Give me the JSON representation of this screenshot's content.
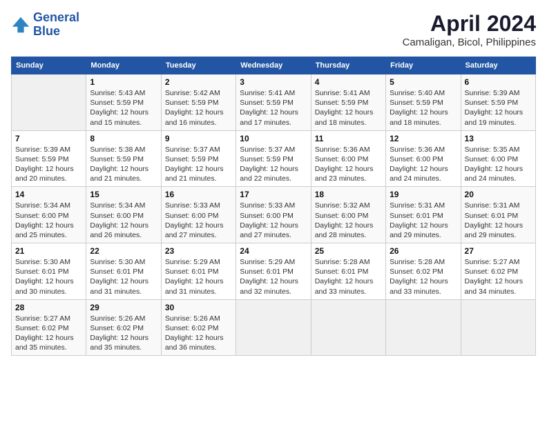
{
  "header": {
    "logo_line1": "General",
    "logo_line2": "Blue",
    "month_year": "April 2024",
    "location": "Camaligan, Bicol, Philippines"
  },
  "days_of_week": [
    "Sunday",
    "Monday",
    "Tuesday",
    "Wednesday",
    "Thursday",
    "Friday",
    "Saturday"
  ],
  "weeks": [
    [
      {
        "day": "",
        "sunrise": "",
        "sunset": "",
        "daylight": ""
      },
      {
        "day": "1",
        "sunrise": "Sunrise: 5:43 AM",
        "sunset": "Sunset: 5:59 PM",
        "daylight": "Daylight: 12 hours and 15 minutes."
      },
      {
        "day": "2",
        "sunrise": "Sunrise: 5:42 AM",
        "sunset": "Sunset: 5:59 PM",
        "daylight": "Daylight: 12 hours and 16 minutes."
      },
      {
        "day": "3",
        "sunrise": "Sunrise: 5:41 AM",
        "sunset": "Sunset: 5:59 PM",
        "daylight": "Daylight: 12 hours and 17 minutes."
      },
      {
        "day": "4",
        "sunrise": "Sunrise: 5:41 AM",
        "sunset": "Sunset: 5:59 PM",
        "daylight": "Daylight: 12 hours and 18 minutes."
      },
      {
        "day": "5",
        "sunrise": "Sunrise: 5:40 AM",
        "sunset": "Sunset: 5:59 PM",
        "daylight": "Daylight: 12 hours and 18 minutes."
      },
      {
        "day": "6",
        "sunrise": "Sunrise: 5:39 AM",
        "sunset": "Sunset: 5:59 PM",
        "daylight": "Daylight: 12 hours and 19 minutes."
      }
    ],
    [
      {
        "day": "7",
        "sunrise": "Sunrise: 5:39 AM",
        "sunset": "Sunset: 5:59 PM",
        "daylight": "Daylight: 12 hours and 20 minutes."
      },
      {
        "day": "8",
        "sunrise": "Sunrise: 5:38 AM",
        "sunset": "Sunset: 5:59 PM",
        "daylight": "Daylight: 12 hours and 21 minutes."
      },
      {
        "day": "9",
        "sunrise": "Sunrise: 5:37 AM",
        "sunset": "Sunset: 5:59 PM",
        "daylight": "Daylight: 12 hours and 21 minutes."
      },
      {
        "day": "10",
        "sunrise": "Sunrise: 5:37 AM",
        "sunset": "Sunset: 5:59 PM",
        "daylight": "Daylight: 12 hours and 22 minutes."
      },
      {
        "day": "11",
        "sunrise": "Sunrise: 5:36 AM",
        "sunset": "Sunset: 6:00 PM",
        "daylight": "Daylight: 12 hours and 23 minutes."
      },
      {
        "day": "12",
        "sunrise": "Sunrise: 5:36 AM",
        "sunset": "Sunset: 6:00 PM",
        "daylight": "Daylight: 12 hours and 24 minutes."
      },
      {
        "day": "13",
        "sunrise": "Sunrise: 5:35 AM",
        "sunset": "Sunset: 6:00 PM",
        "daylight": "Daylight: 12 hours and 24 minutes."
      }
    ],
    [
      {
        "day": "14",
        "sunrise": "Sunrise: 5:34 AM",
        "sunset": "Sunset: 6:00 PM",
        "daylight": "Daylight: 12 hours and 25 minutes."
      },
      {
        "day": "15",
        "sunrise": "Sunrise: 5:34 AM",
        "sunset": "Sunset: 6:00 PM",
        "daylight": "Daylight: 12 hours and 26 minutes."
      },
      {
        "day": "16",
        "sunrise": "Sunrise: 5:33 AM",
        "sunset": "Sunset: 6:00 PM",
        "daylight": "Daylight: 12 hours and 27 minutes."
      },
      {
        "day": "17",
        "sunrise": "Sunrise: 5:33 AM",
        "sunset": "Sunset: 6:00 PM",
        "daylight": "Daylight: 12 hours and 27 minutes."
      },
      {
        "day": "18",
        "sunrise": "Sunrise: 5:32 AM",
        "sunset": "Sunset: 6:00 PM",
        "daylight": "Daylight: 12 hours and 28 minutes."
      },
      {
        "day": "19",
        "sunrise": "Sunrise: 5:31 AM",
        "sunset": "Sunset: 6:01 PM",
        "daylight": "Daylight: 12 hours and 29 minutes."
      },
      {
        "day": "20",
        "sunrise": "Sunrise: 5:31 AM",
        "sunset": "Sunset: 6:01 PM",
        "daylight": "Daylight: 12 hours and 29 minutes."
      }
    ],
    [
      {
        "day": "21",
        "sunrise": "Sunrise: 5:30 AM",
        "sunset": "Sunset: 6:01 PM",
        "daylight": "Daylight: 12 hours and 30 minutes."
      },
      {
        "day": "22",
        "sunrise": "Sunrise: 5:30 AM",
        "sunset": "Sunset: 6:01 PM",
        "daylight": "Daylight: 12 hours and 31 minutes."
      },
      {
        "day": "23",
        "sunrise": "Sunrise: 5:29 AM",
        "sunset": "Sunset: 6:01 PM",
        "daylight": "Daylight: 12 hours and 31 minutes."
      },
      {
        "day": "24",
        "sunrise": "Sunrise: 5:29 AM",
        "sunset": "Sunset: 6:01 PM",
        "daylight": "Daylight: 12 hours and 32 minutes."
      },
      {
        "day": "25",
        "sunrise": "Sunrise: 5:28 AM",
        "sunset": "Sunset: 6:01 PM",
        "daylight": "Daylight: 12 hours and 33 minutes."
      },
      {
        "day": "26",
        "sunrise": "Sunrise: 5:28 AM",
        "sunset": "Sunset: 6:02 PM",
        "daylight": "Daylight: 12 hours and 33 minutes."
      },
      {
        "day": "27",
        "sunrise": "Sunrise: 5:27 AM",
        "sunset": "Sunset: 6:02 PM",
        "daylight": "Daylight: 12 hours and 34 minutes."
      }
    ],
    [
      {
        "day": "28",
        "sunrise": "Sunrise: 5:27 AM",
        "sunset": "Sunset: 6:02 PM",
        "daylight": "Daylight: 12 hours and 35 minutes."
      },
      {
        "day": "29",
        "sunrise": "Sunrise: 5:26 AM",
        "sunset": "Sunset: 6:02 PM",
        "daylight": "Daylight: 12 hours and 35 minutes."
      },
      {
        "day": "30",
        "sunrise": "Sunrise: 5:26 AM",
        "sunset": "Sunset: 6:02 PM",
        "daylight": "Daylight: 12 hours and 36 minutes."
      },
      {
        "day": "",
        "sunrise": "",
        "sunset": "",
        "daylight": ""
      },
      {
        "day": "",
        "sunrise": "",
        "sunset": "",
        "daylight": ""
      },
      {
        "day": "",
        "sunrise": "",
        "sunset": "",
        "daylight": ""
      },
      {
        "day": "",
        "sunrise": "",
        "sunset": "",
        "daylight": ""
      }
    ]
  ]
}
